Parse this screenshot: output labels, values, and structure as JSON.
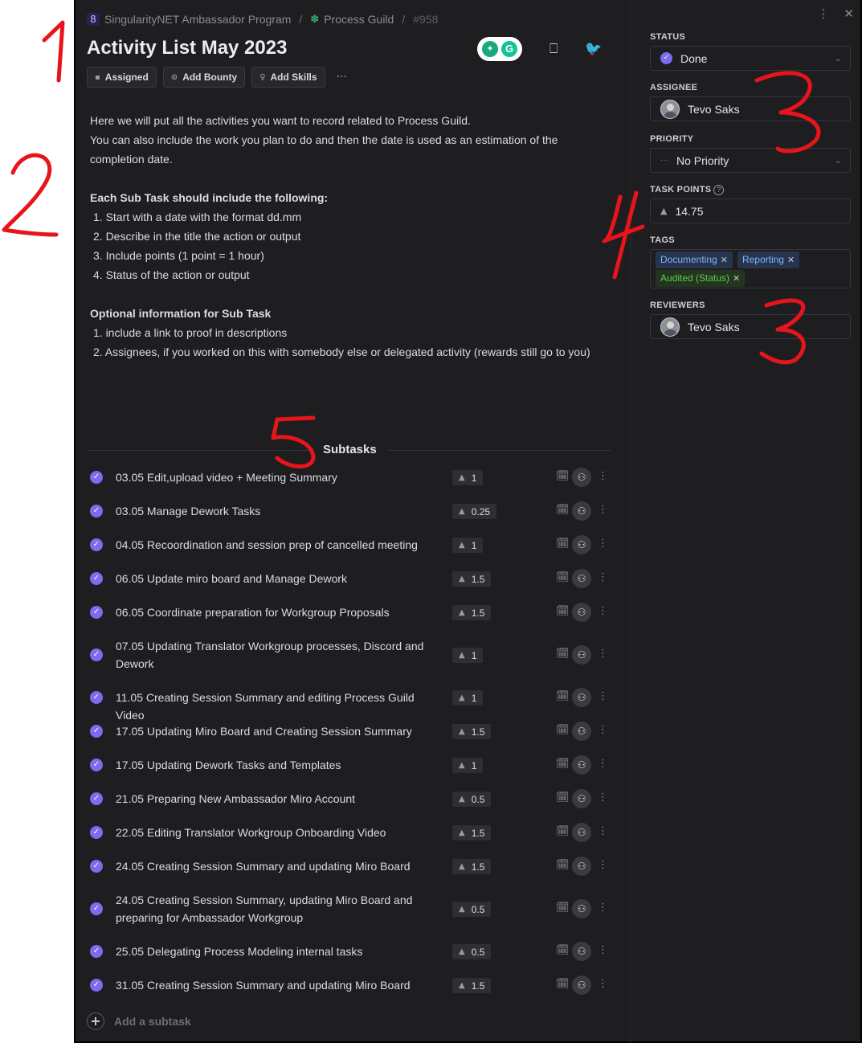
{
  "breadcrumb": {
    "workspace": "SingularityNET Ambassador Program",
    "space": "Process Guild",
    "task_id": "#958",
    "workspace_logo": "8"
  },
  "title": "Activity List May 2023",
  "actions": {
    "assigned": "Assigned",
    "add_bounty": "Add Bounty",
    "add_skills": "Add Skills",
    "more": "···"
  },
  "description": {
    "line1": "Here we will put all the activities you want to record related to Process Guild.",
    "line2": "You can also include the work you plan to do and then the date is used as an estimation of the",
    "line3": "completion date.",
    "sub_task_heading": "Each Sub Task should include the following:",
    "sub_task_items": [
      "1. Start with a date with the format dd.mm",
      "2. Describe in the title the action or output",
      "3. Include points (1 point = 1 hour)",
      "4. Status of the action or output"
    ],
    "optional_heading": "Optional information for Sub Task",
    "optional_items": [
      "1. include a link to proof in descriptions",
      "2. Assignees, if you worked on this with somebody else or delegated activity (rewards still go to you)"
    ]
  },
  "subtasks": {
    "title": "Subtasks",
    "items": [
      {
        "label": "03.05 Edit,upload video + Meeting Summary",
        "points": "1"
      },
      {
        "label": "03.05 Manage Dework Tasks",
        "points": "0.25"
      },
      {
        "label": "04.05 Recoordination and session prep of cancelled meeting",
        "points": "1"
      },
      {
        "label": "06.05 Update miro board and Manage Dework",
        "points": "1.5"
      },
      {
        "label": "06.05 Coordinate preparation for Workgroup Proposals",
        "points": "1.5"
      },
      {
        "label": "07.05 Updating Translator Workgroup processes, Discord and Dework",
        "points": "1"
      },
      {
        "label": "11.05 Creating Session Summary and editing Process Guild Video",
        "points": "1"
      },
      {
        "label": "17.05 Updating Miro Board and Creating Session Summary",
        "points": "1.5"
      },
      {
        "label": "17.05 Updating Dework Tasks and Templates",
        "points": "1"
      },
      {
        "label": "21.05 Preparing New Ambassador Miro Account",
        "points": "0.5"
      },
      {
        "label": "22.05 Editing Translator Workgroup Onboarding Video",
        "points": "1.5"
      },
      {
        "label": "24.05 Creating Session Summary and updating Miro Board",
        "points": "1.5"
      },
      {
        "label": "24.05 Creating Session Summary, updating Miro Board and preparing for Ambassador Workgroup",
        "points": "0.5"
      },
      {
        "label": "25.05 Delegating Process Modeling internal tasks",
        "points": "0.5"
      },
      {
        "label": "31.05 Creating Session Summary and updating Miro Board",
        "points": "1.5"
      }
    ],
    "add_label": "Add a subtask"
  },
  "sidebar": {
    "status_label": "STATUS",
    "status_value": "Done",
    "assignee_label": "ASSIGNEE",
    "assignee_value": "Tevo Saks",
    "priority_label": "PRIORITY",
    "priority_value": "No Priority",
    "priority_icon": "···",
    "task_points_label": "TASK POINTS",
    "task_points_value": "14.75",
    "tags_label": "TAGS",
    "tags": [
      "Documenting",
      "Reporting",
      "Audited (Status)"
    ],
    "reviewers_label": "REVIEWERS",
    "reviewers_value": "Tevo Saks"
  },
  "annotations": [
    "1",
    "2",
    "3",
    "4",
    "3",
    "5"
  ],
  "colors": {
    "accent": "#7b6cf0",
    "annotation": "#e8141b",
    "background": "#1e1e21",
    "tag_green": "#59d04a",
    "tag_blue": "#7fb2ff"
  }
}
